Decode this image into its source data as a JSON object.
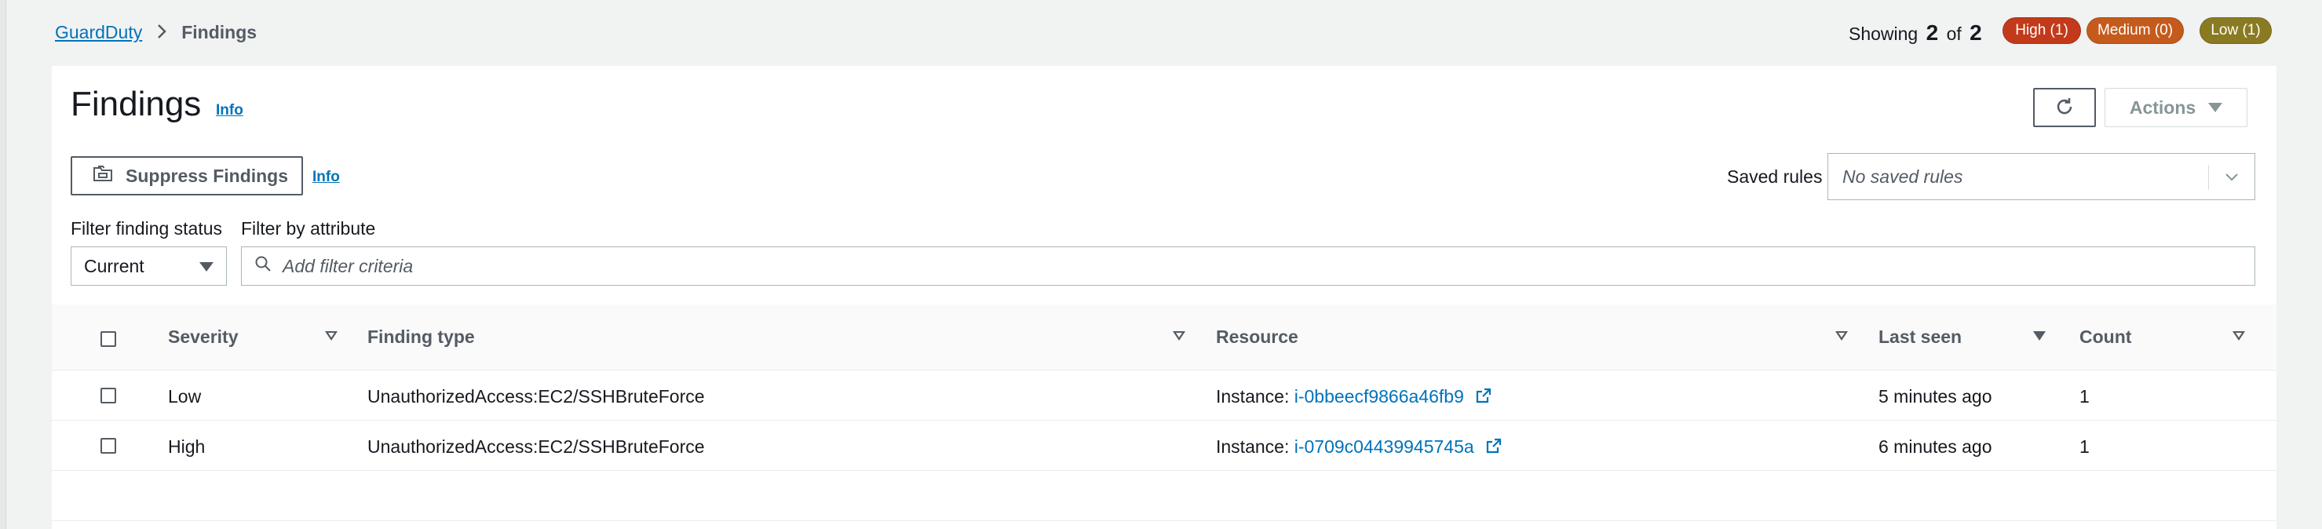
{
  "breadcrumb": {
    "root": "GuardDuty",
    "current": "Findings"
  },
  "summary": {
    "showing_prefix": "Showing",
    "showing_count": "2",
    "of": "of",
    "total": "2",
    "badges": {
      "high": "High (1)",
      "medium": "Medium (0)",
      "low": "Low (1)"
    },
    "colors": {
      "high": "#c23a1a",
      "medium": "#c45b1d",
      "low": "#8a7a22"
    }
  },
  "header": {
    "title": "Findings",
    "info": "Info",
    "actions_label": "Actions"
  },
  "toolbar": {
    "suppress_label": "Suppress Findings",
    "suppress_info": "Info",
    "saved_rules_label": "Saved rules",
    "saved_rules_value": "No saved rules"
  },
  "filters": {
    "status_label": "Filter finding status",
    "status_value": "Current",
    "attribute_label": "Filter by attribute",
    "attribute_placeholder": "Add filter criteria"
  },
  "table": {
    "columns": [
      "Severity",
      "Finding type",
      "Resource",
      "Last seen",
      "Count"
    ],
    "rows": [
      {
        "severity": "Low",
        "finding_type": "UnauthorizedAccess:EC2/SSHBruteForce",
        "resource_prefix": "Instance:",
        "resource_id": "i-0bbeecf9866a46fb9",
        "last_seen": "5 minutes ago",
        "count": "1"
      },
      {
        "severity": "High",
        "finding_type": "UnauthorizedAccess:EC2/SSHBruteForce",
        "resource_prefix": "Instance:",
        "resource_id": "i-0709c04439945745a",
        "last_seen": "6 minutes ago",
        "count": "1"
      }
    ]
  },
  "icons": [
    "refresh-icon",
    "suppress-icon",
    "search-icon",
    "chevron-down-icon",
    "external-link-icon",
    "sort-icon",
    "breadcrumb-chevron-icon"
  ]
}
